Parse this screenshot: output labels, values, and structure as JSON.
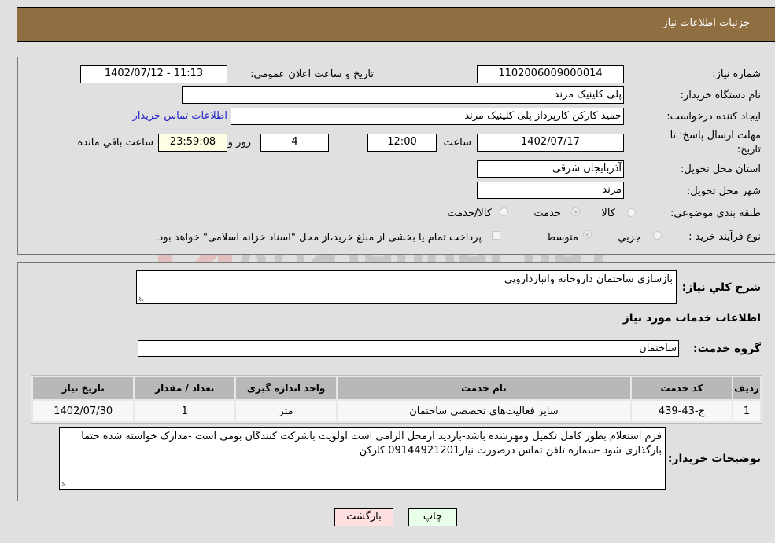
{
  "header": {
    "title": "جزئیات اطلاعات نیاز"
  },
  "details": {
    "need_number_label": "شماره نیاز:",
    "need_number": "1102006009000014",
    "announce_label": "تاریخ و ساعت اعلان عمومی:",
    "announce_value": "1402/07/12 - 11:13",
    "buyer_org_label": "نام دستگاه خریدار:",
    "buyer_org": "پلی کلینیک مرند",
    "creator_label": "ایجاد کننده درخواست:",
    "creator": "حمید کارکن کارپرداز پلی کلینیک مرند",
    "contact_link": "اطلاعات تماس خریدار",
    "deadline_label_1": "مهلت ارسال پاسخ: تا",
    "deadline_label_2": "تاریخ:",
    "deadline_date": "1402/07/17",
    "time_label": "ساعت",
    "deadline_time": "12:00",
    "days_value": "4",
    "days_label": "روز و",
    "remaining_time": "23:59:08",
    "remaining_label": "ساعت باقي مانده",
    "province_label": "استان محل تحویل:",
    "province": "آذربایجان شرقی",
    "city_label": "شهر محل تحویل:",
    "city": "مرند",
    "category_label": "طبقه بندی موضوعی:",
    "category_options": [
      "کالا",
      "خدمت",
      "کالا/خدمت"
    ],
    "category_selected": "خدمت",
    "process_label": "نوع فرآیند خرید :",
    "process_options": [
      "جزيي",
      "متوسط"
    ],
    "process_selected": "متوسط",
    "treasury_note": "پرداخت تمام یا بخشی از مبلغ خرید،از محل \"اسناد خزانه اسلامی\" خواهد بود.",
    "treasury_checked": false
  },
  "summary": {
    "general_desc_label": "شرح کلي نیاز:",
    "general_desc": "بازسازی ساختمان داروخانه وانبارداروپی",
    "services_heading": "اطلاعات خدمات مورد نیاز",
    "service_group_label": "گروه خدمت:",
    "service_group": "ساختمان",
    "table": {
      "headers": [
        "ردیف",
        "کد خدمت",
        "نام خدمت",
        "واحد اندازه گیری",
        "تعداد / مقدار",
        "تاریخ نیاز"
      ],
      "rows": [
        [
          "1",
          "ج-43-439",
          "سایر فعالیت‌های تخصصی ساختمان",
          "متر",
          "1",
          "1402/07/30"
        ]
      ]
    },
    "buyer_notes_label": "توضیحات خریدار:",
    "buyer_notes": "فرم استعلام بطور کامل تکمیل ومهرشده باشد-بازدید ازمحل الزامی است اولویت باشرکت کنندگان بومی است -مدارک خواسته شده حتما بارگذاری شود -شماره تلفن تماس درصورت نیاز09144921201  کارکن"
  },
  "buttons": {
    "print": "چاپ",
    "back": "بازگشت"
  },
  "watermark": {
    "text": "AriaTender.neT"
  },
  "colors": {
    "header_bg": "#8f6e42",
    "print_bg": "#eaffea",
    "back_bg": "#ffe0e0",
    "link": "#2323c8",
    "countdown_bg": "#ffffe6"
  }
}
